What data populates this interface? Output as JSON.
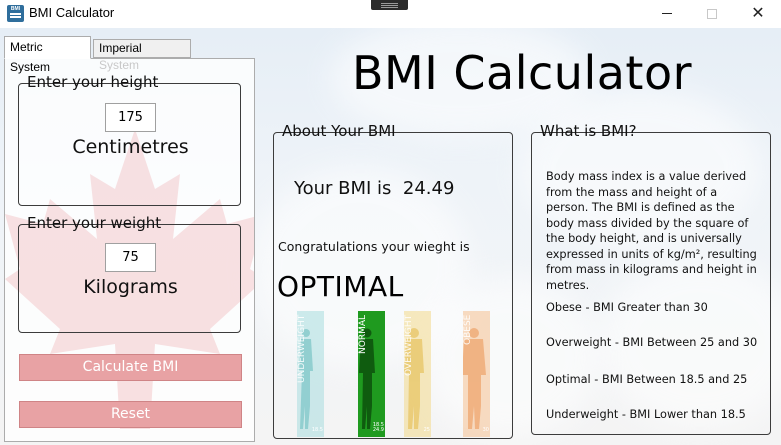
{
  "window": {
    "title": "BMI Calculator",
    "icon": "bmi-app-icon",
    "icon_text": "BMI",
    "min_glyph": "—",
    "max_glyph": "☐",
    "close_glyph": "✕"
  },
  "tabs": [
    {
      "label": "Metric System",
      "active": true
    },
    {
      "label": "Imperial System",
      "active": false
    }
  ],
  "height_group": {
    "title": "Enter your height",
    "value": "175",
    "unit": "Centimetres"
  },
  "weight_group": {
    "title": "Enter your weight",
    "value": "75",
    "unit": "Kilograms"
  },
  "buttons": {
    "calculate": "Calculate BMI",
    "reset": "Reset"
  },
  "main_title": "BMI Calculator",
  "about": {
    "title": "About Your BMI",
    "bmi_label": "Your BMI is",
    "bmi_value": "24.49",
    "congrats": "Congratulations your wieght is",
    "result": "OPTIMAL",
    "figures": [
      {
        "label": "UNDERWEIGHT",
        "range": "18.5",
        "color": "#a7ddde"
      },
      {
        "label": "NORMAL",
        "range": "18.5\n24.9",
        "color": "#1f9a1f"
      },
      {
        "label": "OVERWEIGHT",
        "range": "25",
        "color": "#f2d98a"
      },
      {
        "label": "OBESE",
        "range": "30",
        "color": "#f5c49a"
      }
    ]
  },
  "what": {
    "title": "What is BMI?",
    "description": "Body mass index is a value derived from the mass and height of a person. The BMI is defined as the body mass divided by the square of the body height, and is universally expressed in units of kg/m², resulting from mass in kilograms and height in metres.",
    "obese": "Obese - BMI Greater than 30",
    "overweight": "Overweight - BMI Between 25 and 30",
    "optimal": "Optimal - BMI Between 18.5 and 25",
    "underweight": "Underweight - BMI Lower than 18.5"
  },
  "colors": {
    "button_bg": "#e8a2a4",
    "leaf_red": "#d91f26",
    "normal_green": "#1f9a1f"
  }
}
